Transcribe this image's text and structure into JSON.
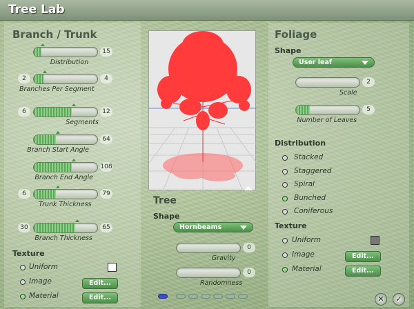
{
  "window": {
    "title": "Tree Lab"
  },
  "branch": {
    "header": "Branch / Trunk",
    "sliders": [
      {
        "label": "Distribution",
        "value": "15",
        "level": 0.12
      },
      {
        "label": "Branches Per Segment",
        "min": "2",
        "value": "4",
        "level": 0.15
      },
      {
        "label": "Segments",
        "min": "6",
        "value": "12",
        "level": 0.6
      },
      {
        "label": "Branch Start Angle",
        "value": "64",
        "level": 0.35
      },
      {
        "label": "Branch End Angle",
        "value": "108",
        "level": 0.6
      },
      {
        "label": "Trunk Thickness",
        "min": "6",
        "value": "79",
        "level": 0.35
      },
      {
        "label": "Branch Thickness",
        "min": "30",
        "value": "65",
        "level": 0.65
      }
    ],
    "texture": {
      "header": "Texture",
      "options": [
        "Uniform",
        "Image",
        "Material"
      ],
      "selected": 2,
      "edit": "Edit...",
      "swatch_color": "#ffffff"
    }
  },
  "tree": {
    "header": "Tree",
    "shape_label": "Shape",
    "shape_value": "Hornbeams",
    "sliders": [
      {
        "label": "Gravity",
        "value": "0",
        "level": 0.0
      },
      {
        "label": "Randomness",
        "value": "0",
        "level": 0.0
      }
    ]
  },
  "foliage": {
    "header": "Foliage",
    "shape_label": "Shape",
    "shape_value": "User leaf",
    "sliders": [
      {
        "label": "Scale",
        "value": "2",
        "level": 0.0
      },
      {
        "label": "Number of Leaves",
        "value": "5",
        "level": 0.22
      }
    ],
    "distribution": {
      "header": "Distribution",
      "options": [
        "Stacked",
        "Staggered",
        "Spiral",
        "Bunched",
        "Coniferous"
      ],
      "selected": 3
    },
    "texture": {
      "header": "Texture",
      "options": [
        "Uniform",
        "Image",
        "Material"
      ],
      "selected": 2,
      "edit": "Edit...",
      "swatch_color": "#777777"
    }
  },
  "colors": {
    "accent": "#5ea65a",
    "tree": "#ff3b3b"
  }
}
